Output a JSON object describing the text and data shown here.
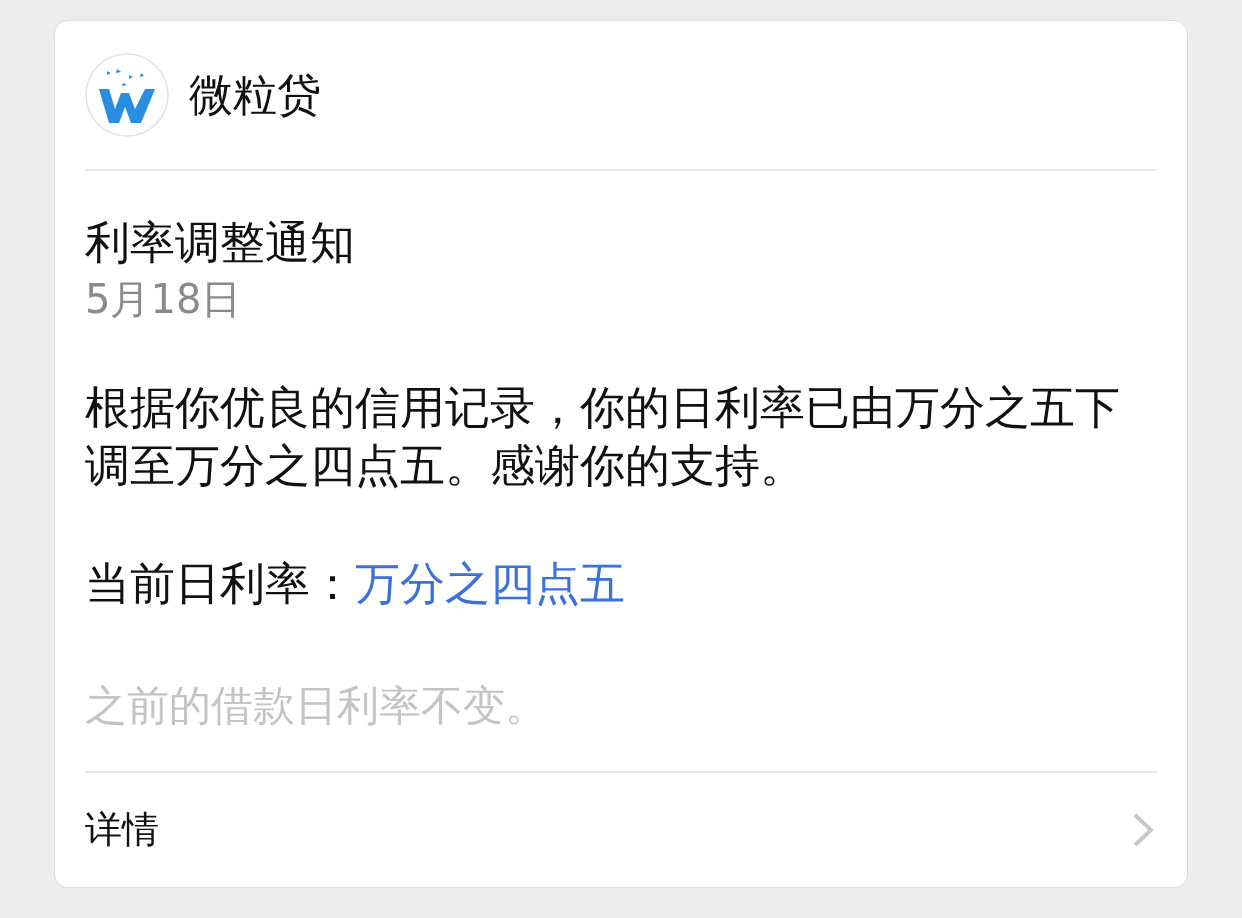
{
  "header": {
    "app_name": "微粒贷"
  },
  "notice": {
    "title": "利率调整通知",
    "date": "5月18日",
    "body": "根据你优良的信用记录，你的日利率已由万分之五下调至万分之四点五。感谢你的支持。",
    "rate_label": "当前日利率：",
    "rate_value": "万分之四点五",
    "note": "之前的借款日利率不变。"
  },
  "footer": {
    "link": "详情"
  }
}
